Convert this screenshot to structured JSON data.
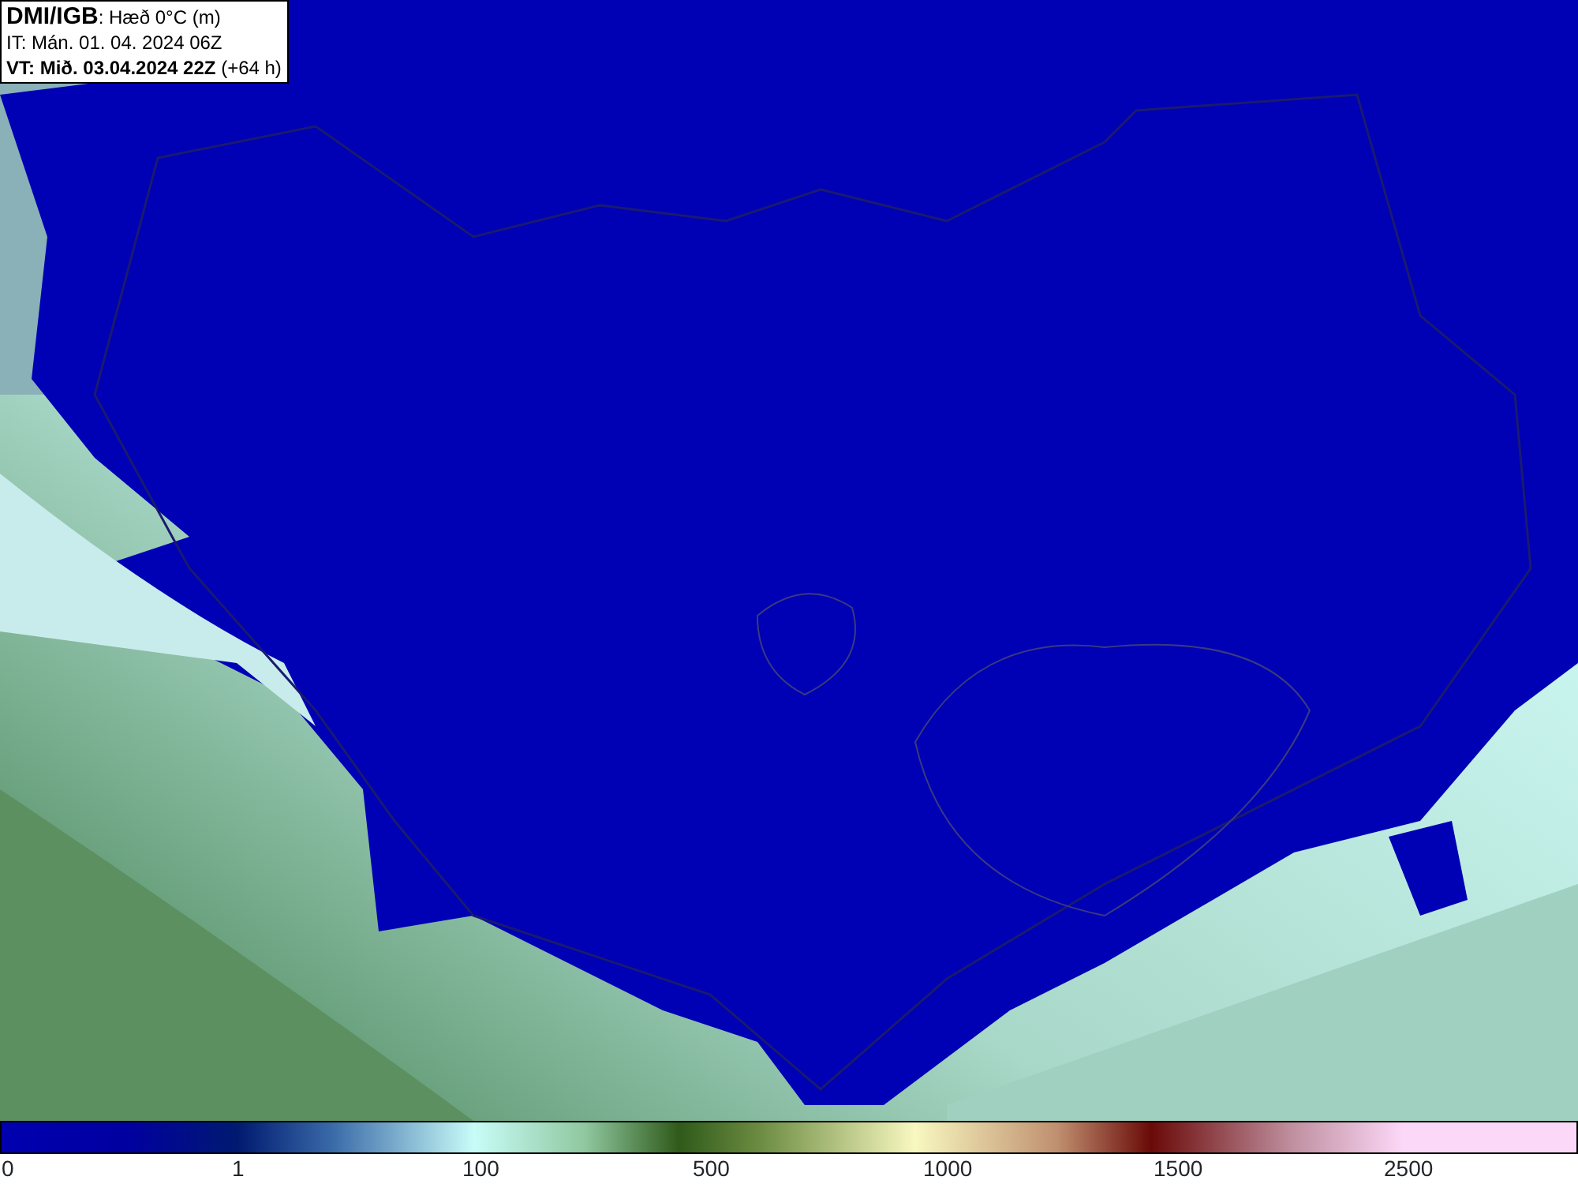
{
  "title_box": {
    "lines": [
      "**DMI/IGB**: Hæð 0°C (m)",
      "IT: Mán. 01. 04. 2024 06Z",
      "**VT: Mið. 03.04.2024 22Z** (+64 h)"
    ]
  },
  "legend": {
    "labels": [
      "0",
      "1",
      "100",
      "500",
      "1000",
      "1500",
      "2500"
    ]
  }
}
